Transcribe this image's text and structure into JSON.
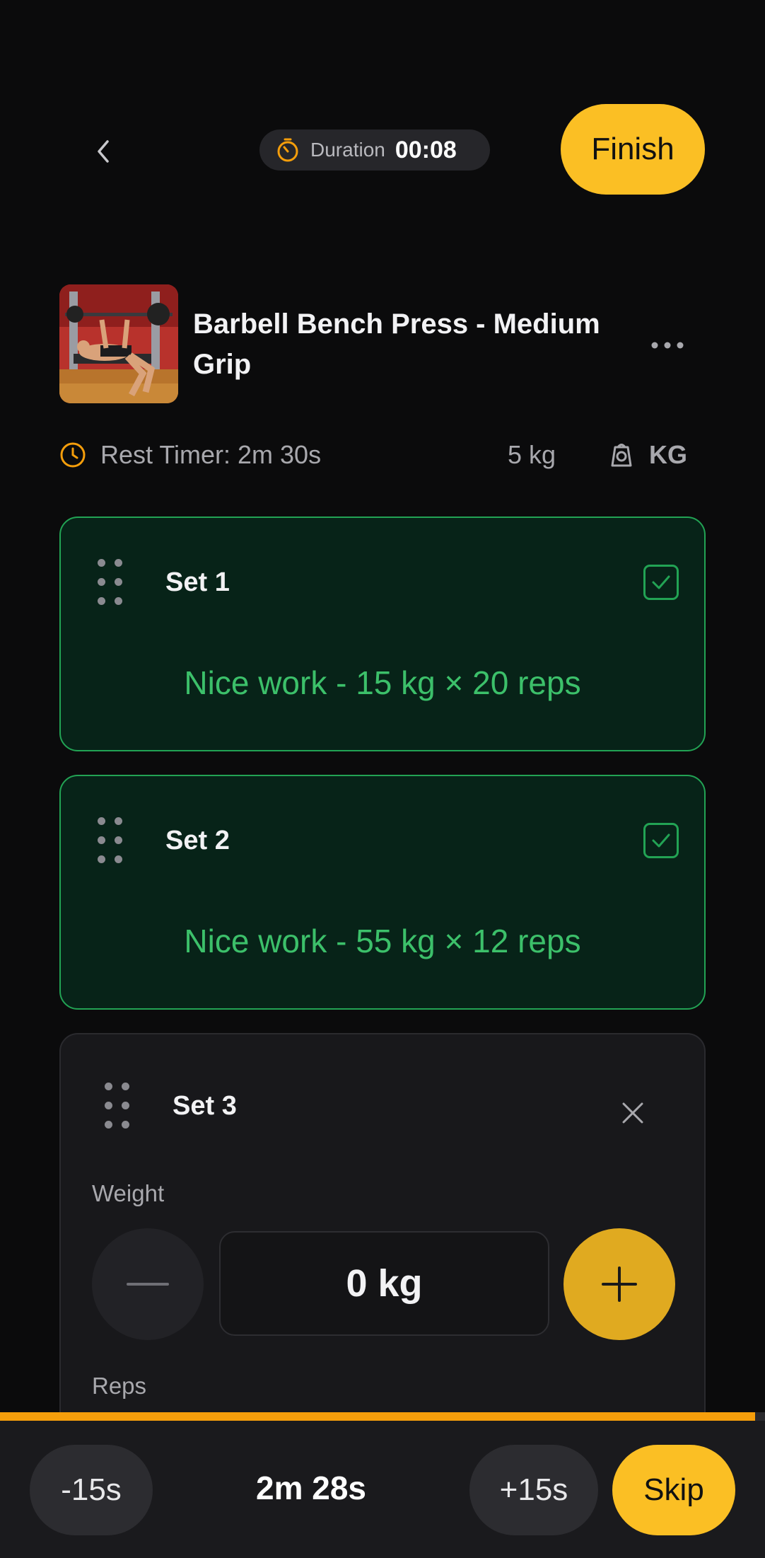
{
  "header": {
    "duration_label": "Duration",
    "duration_value": "00:08",
    "finish_label": "Finish"
  },
  "exercise": {
    "title": "Barbell Bench Press - Medium Grip",
    "rest_timer": "Rest Timer: 2m 30s",
    "weight_increment": "5 kg",
    "unit": "KG"
  },
  "sets": [
    {
      "label": "Set 1",
      "result": "Nice work - 15 kg × 20 reps",
      "completed": true
    },
    {
      "label": "Set 2",
      "result": "Nice work - 55 kg × 12 reps",
      "completed": true
    }
  ],
  "active_set": {
    "label": "Set 3",
    "weight_label": "Weight",
    "weight_value": "0 kg",
    "reps_label": "Reps"
  },
  "rest_bar": {
    "minus_label": "-15s",
    "remaining": "2m 28s",
    "plus_label": "+15s",
    "skip_label": "Skip",
    "progress": 0.987
  },
  "colors": {
    "accent": "#fbbf24",
    "success": "#22a354",
    "success_text": "#3cc06a",
    "progress": "#f59e0b"
  }
}
